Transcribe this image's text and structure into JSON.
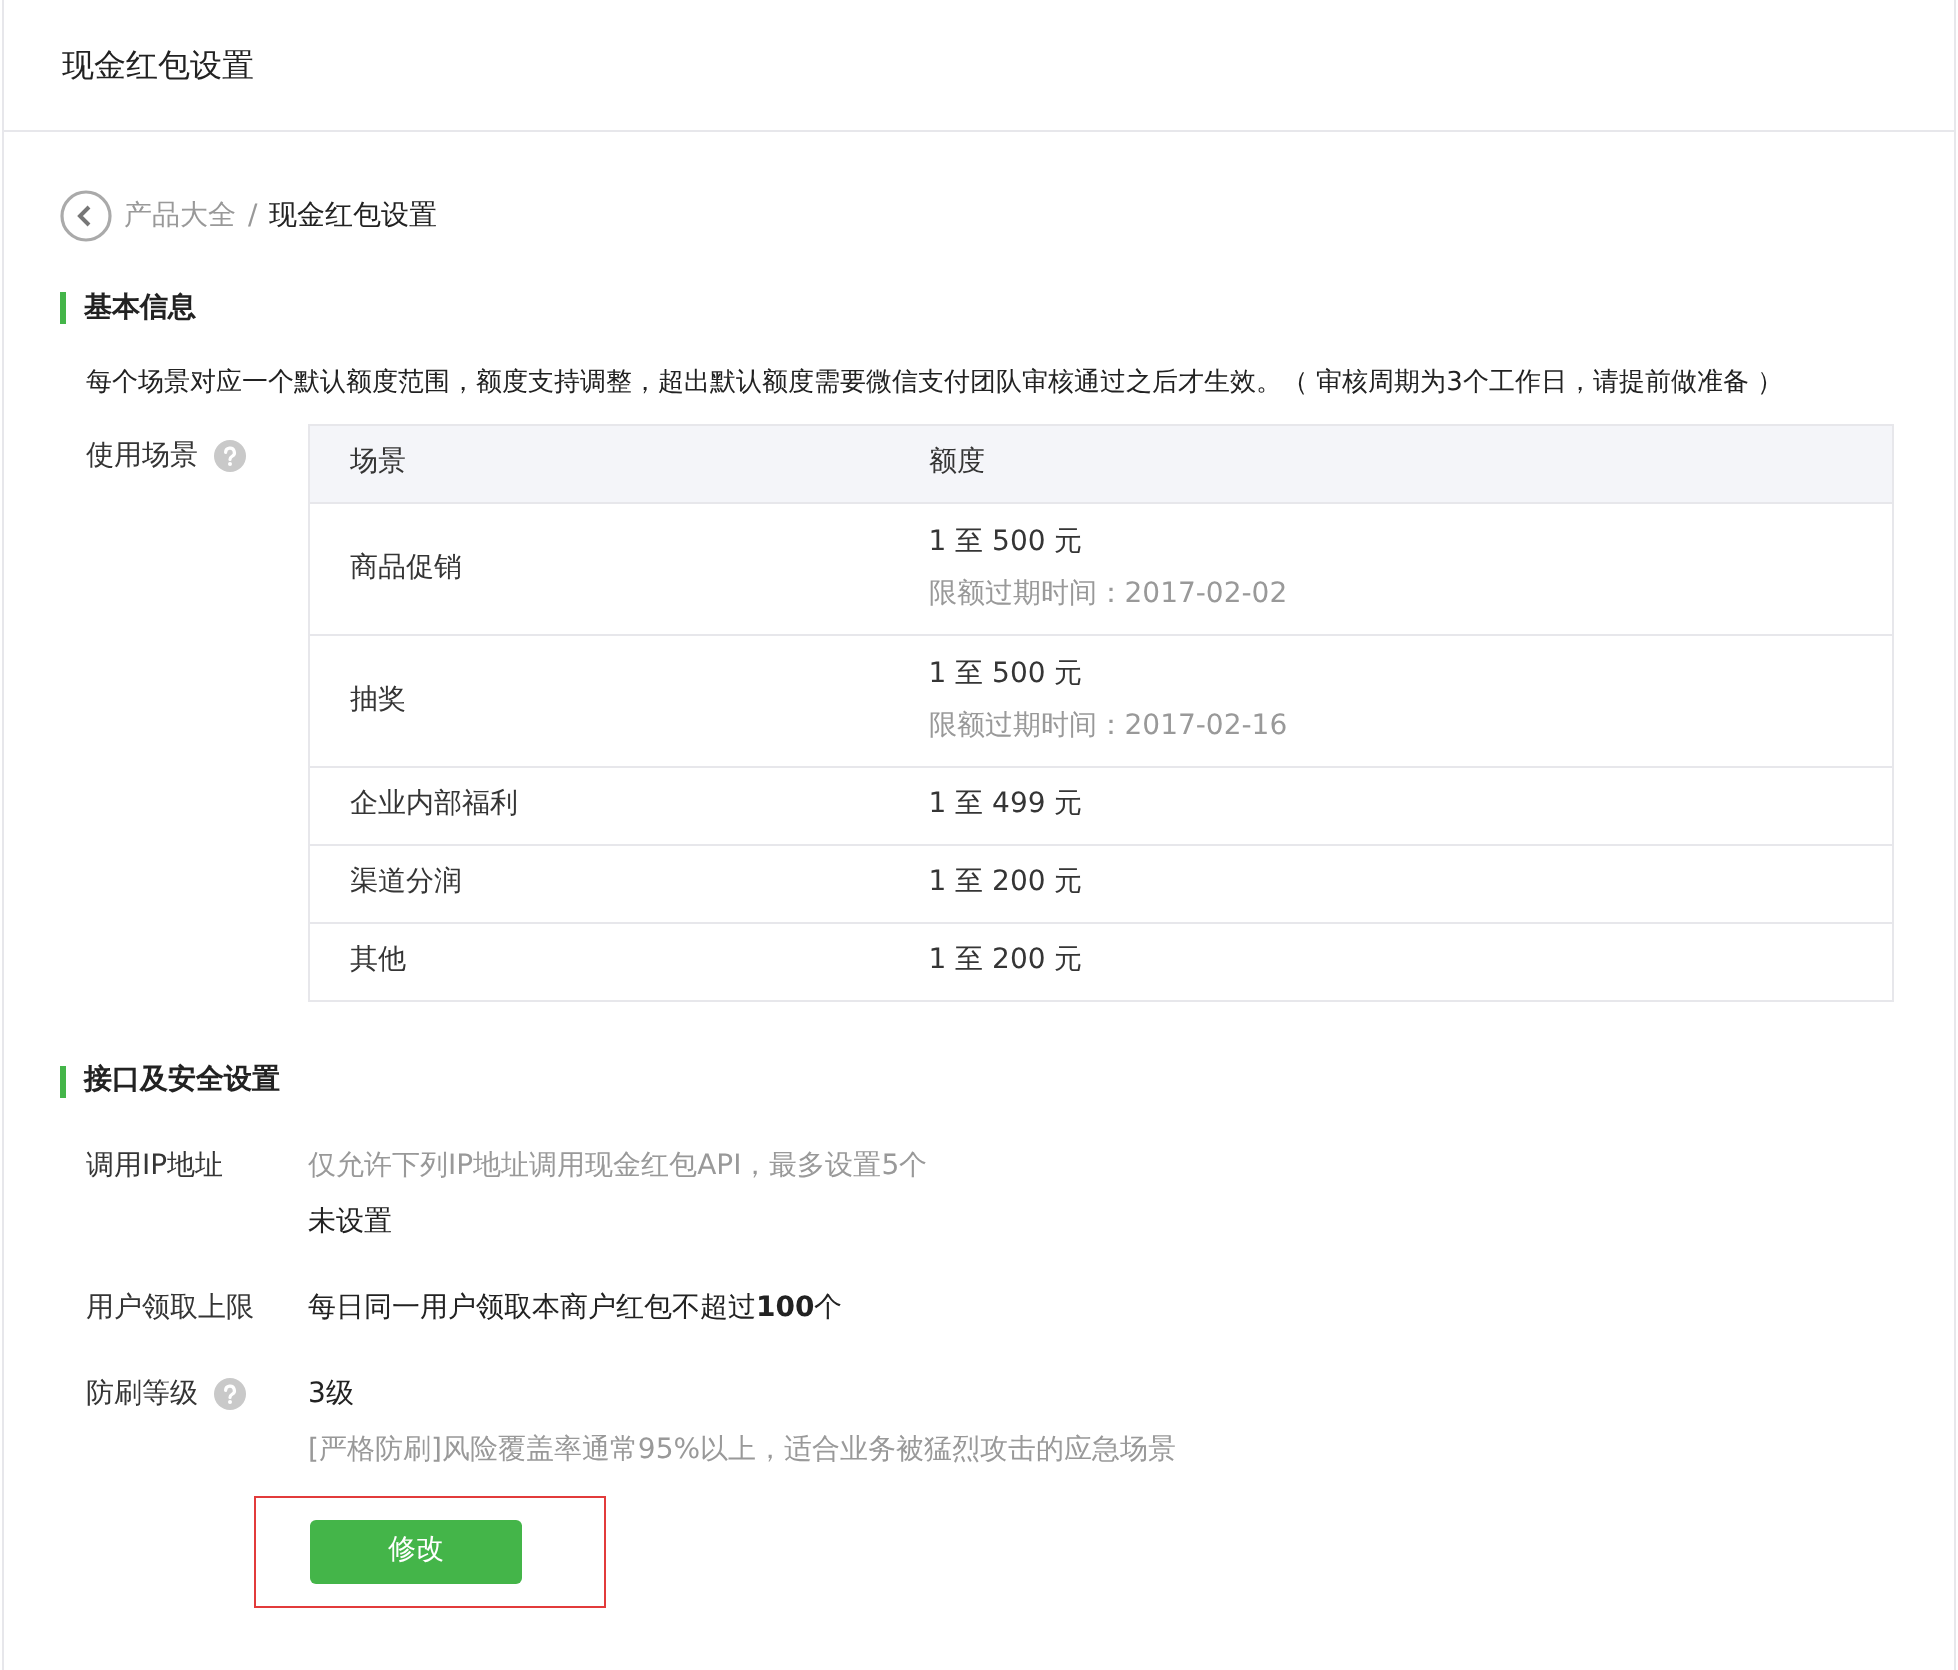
{
  "header": {
    "title": "现金红包设置"
  },
  "breadcrumb": {
    "parent": "产品大全",
    "separator": "/",
    "current": "现金红包设置"
  },
  "basic_info": {
    "title": "基本信息",
    "description": "每个场景对应一个默认额度范围，额度支持调整，超出默认额度需要微信支付团队审核通过之后才生效。（ 审核周期为3个工作日，请提前做准备 ）",
    "field_label": "使用场景",
    "help": true,
    "table": {
      "columns": [
        "场景",
        "额度"
      ],
      "rows": [
        {
          "scene": "商品促销",
          "quota": "1 至 500 元",
          "expiry": "限额过期时间：2017-02-02"
        },
        {
          "scene": "抽奖",
          "quota": "1 至 500 元",
          "expiry": "限额过期时间：2017-02-16"
        },
        {
          "scene": "企业内部福利",
          "quota": "1 至 499 元"
        },
        {
          "scene": "渠道分润",
          "quota": "1 至 200 元"
        },
        {
          "scene": "其他",
          "quota": "1 至 200 元"
        }
      ]
    }
  },
  "security": {
    "title": "接口及安全设置",
    "rows": [
      {
        "label": "调用IP地址",
        "help": false,
        "lines": [
          {
            "text": "仅允许下列IP地址调用现金红包API，最多设置5个",
            "muted": true
          },
          {
            "text": "未设置",
            "muted": false
          }
        ]
      },
      {
        "label": "用户领取上限",
        "help": false,
        "lines": [
          {
            "text": "每日同一用户领取本商户红包不超过**100**个",
            "muted": false
          }
        ]
      },
      {
        "label": "防刷等级",
        "help": true,
        "lines": [
          {
            "text": "3级",
            "muted": false
          },
          {
            "text": "[严格防刷]风险覆盖率通常95%以上，适合业务被猛烈攻击的应急场景",
            "muted": true
          }
        ]
      }
    ]
  },
  "edit_button": {
    "label": "修改",
    "highlighted": true
  }
}
